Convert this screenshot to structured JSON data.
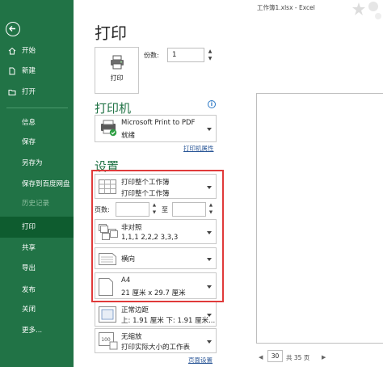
{
  "window": {
    "title": "工作簿1.xlsx  -  Excel"
  },
  "nav": {
    "items": [
      {
        "label": "开始",
        "icon": "home-icon"
      },
      {
        "label": "新建",
        "icon": "new-file-icon"
      },
      {
        "label": "打开",
        "icon": "open-folder-icon"
      },
      {
        "label": "信息"
      },
      {
        "label": "保存"
      },
      {
        "label": "另存为"
      },
      {
        "label": "保存到百度网盘"
      },
      {
        "label": "历史记录"
      },
      {
        "label": "打印"
      },
      {
        "label": "共享"
      },
      {
        "label": "导出"
      },
      {
        "label": "发布"
      },
      {
        "label": "关闭"
      },
      {
        "label": "更多..."
      }
    ],
    "active": "打印",
    "colors": {
      "background": "#217346",
      "active": "#0e5c2f"
    }
  },
  "print": {
    "title": "打印",
    "button_label": "打印",
    "copies_label": "份数:",
    "copies_value": "1"
  },
  "printer": {
    "heading": "打印机",
    "name": "Microsoft Print to PDF",
    "status": "就绪",
    "properties_link": "打印机属性"
  },
  "settings": {
    "heading": "设置",
    "scope": {
      "line1": "打印整个工作簿",
      "line2": "打印整个工作簿"
    },
    "pages_label": "页数:",
    "to_label": "至",
    "collate": {
      "line1": "非对照",
      "line2": "1,1,1    2,2,2    3,3,3"
    },
    "orientation": {
      "line1": "横向"
    },
    "paper": {
      "line1": "A4",
      "line2": "21 厘米 x 29.7 厘米"
    },
    "margins": {
      "line1": "正常边距",
      "line2": "上: 1.91 厘米 下: 1.91 厘米..."
    },
    "scaling": {
      "line1": "无缩放",
      "line2": "打印实际大小的工作表"
    },
    "page_setup_link": "页面设置",
    "highlight_color": "#e03a3a"
  },
  "preview": {
    "current_page": "30",
    "total_pages": "共 35 页",
    "prev_icon": "chevron-left-icon",
    "next_icon": "chevron-right-icon"
  }
}
